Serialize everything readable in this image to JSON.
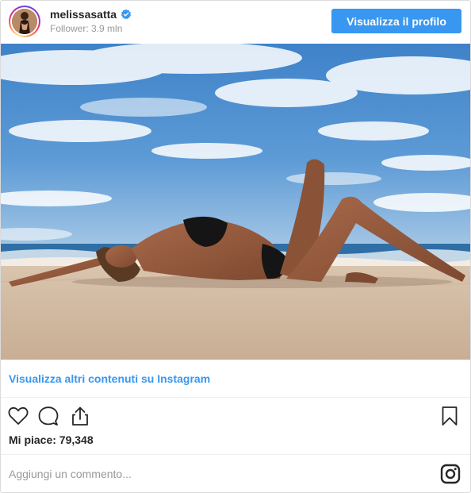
{
  "header": {
    "username": "melissasatta",
    "verified": true,
    "followers": "Follower: 3.9 mln",
    "profile_button_label": "Visualizza il profilo",
    "avatar_icon": "avatar-photo"
  },
  "post": {
    "image_icon": "beach-photo",
    "more_link": "Visualizza altri contenuti su Instagram",
    "likes": "Mi piace: 79,348"
  },
  "actions": {
    "like_icon": "heart-icon",
    "comment_icon": "comment-icon",
    "share_icon": "share-icon",
    "save_icon": "bookmark-icon"
  },
  "comment": {
    "placeholder": "Aggiungi un commento...",
    "brand_icon": "instagram-icon"
  },
  "colors": {
    "accent": "#3897f0",
    "text": "#262626",
    "muted": "#999999",
    "border": "#dbdbdb",
    "verified": "#3897f0"
  }
}
